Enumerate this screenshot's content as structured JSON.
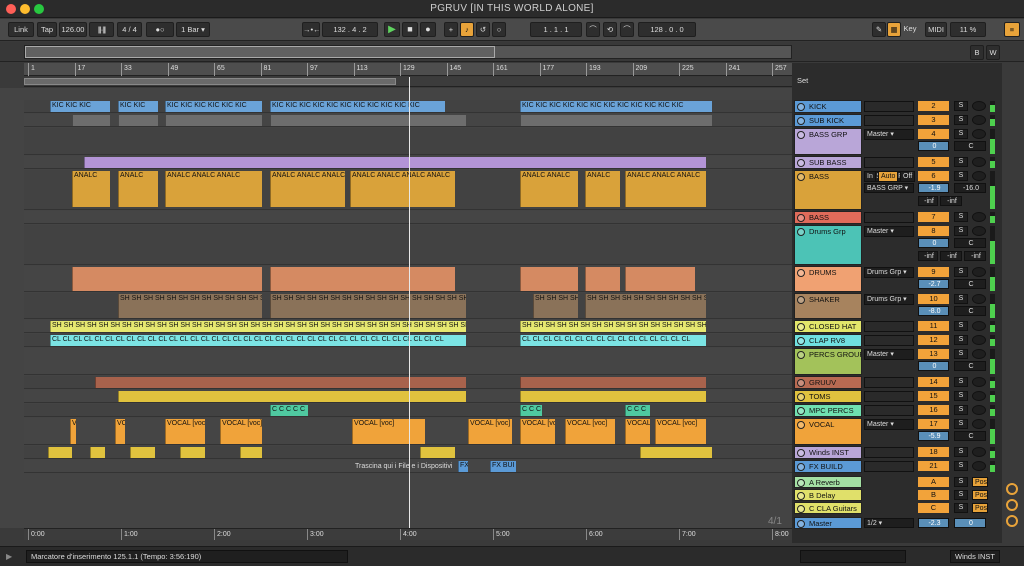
{
  "window": {
    "title": "PGRUV  [IN THIS WORLD ALONE]"
  },
  "control_bar": {
    "link": "Link",
    "tap": "Tap",
    "tempo": "126.00",
    "signature": "4 / 4",
    "metronome": "●○",
    "quantize": "1 Bar ▾",
    "position": "132 . 4 . 2",
    "loop_start": "1 . 1 . 1",
    "loop_length": "128 . 0 . 0",
    "key": "Key",
    "midi": "MIDI",
    "cpu": "11 %"
  },
  "overview": {
    "set_label": "Set",
    "w_label": "W",
    "b_label": "B"
  },
  "ruler": {
    "bars": [
      "1",
      "17",
      "33",
      "49",
      "65",
      "81",
      "97",
      "113",
      "129",
      "145",
      "161",
      "177",
      "193",
      "209",
      "225",
      "241",
      "257"
    ]
  },
  "timeline": {
    "times": [
      "0:00",
      "1:00",
      "2:00",
      "3:00",
      "4:00",
      "5:00",
      "6:00",
      "7:00",
      "8:00"
    ],
    "loop_indicator": "4/1"
  },
  "drop_hint": "Trascina qui i File e i Dispositivi",
  "tracks": [
    {
      "name": "KICK",
      "color": "#5b9ad6",
      "num": "2",
      "h": 13,
      "clip": "KIC",
      "clipcolor": "#6aa3d8",
      "segs": [
        [
          50,
          110
        ],
        [
          118,
          158
        ],
        [
          165,
          262
        ],
        [
          270,
          445
        ],
        [
          520,
          712
        ]
      ]
    },
    {
      "name": "SUB KICK",
      "color": "#5b9ad6",
      "num": "3",
      "h": 13,
      "clip": "",
      "clipcolor": "#6d6d6d",
      "segs": [
        [
          72,
          110
        ],
        [
          118,
          158
        ],
        [
          165,
          262
        ],
        [
          270,
          466
        ],
        [
          520,
          712
        ]
      ]
    },
    {
      "name": "BASS GRP",
      "color": "#b9a6d8",
      "num": "4",
      "h": 27,
      "route": "Master",
      "vol": "0",
      "clip": "",
      "clipcolor": "#555",
      "segs": []
    },
    {
      "name": "SUB BASS",
      "color": "#b9a6d8",
      "num": "5",
      "h": 13,
      "clip": "",
      "clipcolor": "#b394d6",
      "segs": [
        [
          84,
          706
        ]
      ]
    },
    {
      "name": "BASS",
      "color": "#d9a23a",
      "num": "6",
      "h": 40,
      "route": "BASS GRP",
      "vol": "-1.9",
      "pan": "-16.0",
      "inf1": "-inf",
      "inf2": "-inf",
      "in": "In",
      "auto": "Auto",
      "off": "Off",
      "clip": "ANALC",
      "clipcolor": "#d9a23a",
      "segs": [
        [
          72,
          110
        ],
        [
          118,
          158
        ],
        [
          165,
          262
        ],
        [
          270,
          345
        ],
        [
          350,
          455
        ],
        [
          520,
          578
        ],
        [
          585,
          620
        ],
        [
          625,
          706
        ]
      ]
    },
    {
      "name": "BASS",
      "color": "#e06b5a",
      "num": "7",
      "h": 13,
      "clip": "",
      "clipcolor": "#555",
      "segs": []
    },
    {
      "name": "Drums Grp",
      "color": "#4cc3b6",
      "num": "8",
      "h": 40,
      "route": "Master",
      "vol": "0",
      "inf1": "-inf",
      "inf2": "-inf",
      "inf3": "-inf",
      "clip": "",
      "clipcolor": "#555",
      "segs": []
    },
    {
      "name": "DRUMS",
      "color": "#f0a172",
      "num": "9",
      "h": 26,
      "route": "Drums Grp",
      "vol": "-2.7",
      "clip": "",
      "clipcolor": "#d58a62",
      "segs": [
        [
          72,
          262
        ],
        [
          270,
          455
        ],
        [
          520,
          578
        ],
        [
          585,
          620
        ],
        [
          625,
          695
        ]
      ]
    },
    {
      "name": "SHAKER",
      "color": "#a7835e",
      "num": "10",
      "h": 26,
      "route": "Drums Grp",
      "vol": "-8.0",
      "clip": "SH",
      "clipcolor": "#8a7259",
      "segs": [
        [
          118,
          262
        ],
        [
          270,
          466
        ],
        [
          533,
          578
        ],
        [
          585,
          706
        ]
      ]
    },
    {
      "name": "CLOSED HAT",
      "color": "#e2e66a",
      "num": "11",
      "h": 13,
      "clip": "SH",
      "clipcolor": "#e6e870",
      "segs": [
        [
          50,
          466
        ],
        [
          520,
          706
        ]
      ]
    },
    {
      "name": "CLAP RV8",
      "color": "#6fe0e0",
      "num": "12",
      "h": 13,
      "clip": "CL",
      "clipcolor": "#7be4e4",
      "segs": [
        [
          50,
          466
        ],
        [
          520,
          706
        ]
      ]
    },
    {
      "name": "PERCS GROUP",
      "color": "#a3c25a",
      "num": "13",
      "h": 27,
      "route": "Master",
      "vol": "0",
      "clip": "",
      "clipcolor": "#555",
      "segs": []
    },
    {
      "name": "GRUUV",
      "color": "#b86a52",
      "num": "14",
      "h": 13,
      "clip": "",
      "clipcolor": "#a8624c",
      "segs": [
        [
          95,
          466
        ],
        [
          520,
          706
        ]
      ]
    },
    {
      "name": "TOMS",
      "color": "#e0c23e",
      "num": "15",
      "h": 13,
      "clip": "",
      "clipcolor": "#e0c23e",
      "segs": [
        [
          118,
          466
        ],
        [
          520,
          706
        ]
      ]
    },
    {
      "name": "MPC PERCS",
      "color": "#6fe0b0",
      "num": "16",
      "h": 13,
      "clip": "C",
      "clipcolor": "#4fc9a0",
      "segs": [
        [
          270,
          308
        ],
        [
          520,
          542
        ],
        [
          625,
          650
        ]
      ]
    },
    {
      "name": "VOCAL",
      "color": "#f0a33a",
      "num": "17",
      "h": 27,
      "route": "Master",
      "vol": "-5.9",
      "clip": "VOCAL [voc]",
      "clipcolor": "#f0a33a",
      "segs": [
        [
          70,
          76
        ],
        [
          115,
          125
        ],
        [
          165,
          205
        ],
        [
          220,
          262
        ],
        [
          352,
          425
        ],
        [
          468,
          512
        ],
        [
          520,
          555
        ],
        [
          565,
          615
        ],
        [
          625,
          650
        ],
        [
          655,
          706
        ]
      ]
    },
    {
      "name": "Winds INST",
      "color": "#b9a6d8",
      "num": "18",
      "h": 13,
      "clip": "",
      "clipcolor": "#e0c23e",
      "segs": [
        [
          48,
          72
        ],
        [
          90,
          105
        ],
        [
          130,
          155
        ],
        [
          180,
          205
        ],
        [
          240,
          262
        ],
        [
          420,
          455
        ],
        [
          640,
          712
        ]
      ]
    },
    {
      "name": "FX BUILD",
      "color": "#5b9ad6",
      "num": "21",
      "h": 13,
      "clip": "FX BUI",
      "clipcolor": "#5b9ad6",
      "segs": [
        [
          458,
          468
        ],
        [
          490,
          516
        ]
      ]
    }
  ],
  "returns": [
    {
      "name": "A Reverb",
      "color": "#a3e0a3",
      "num": "A",
      "post": "Post"
    },
    {
      "name": "B Delay",
      "color": "#e0e06a",
      "num": "B",
      "post": "Post"
    },
    {
      "name": "C CLA Guitars",
      "color": "#e0e06a",
      "num": "C",
      "post": "Post"
    }
  ],
  "master": {
    "name": "Master",
    "color": "#5b9ad6",
    "route": "1/2",
    "vol": "-2.3",
    "pan": "0"
  },
  "status": {
    "marker": "Marcatore d'inserimento 125.1.1 (Tempo: 3:56:190)",
    "track": "Winds INST"
  }
}
